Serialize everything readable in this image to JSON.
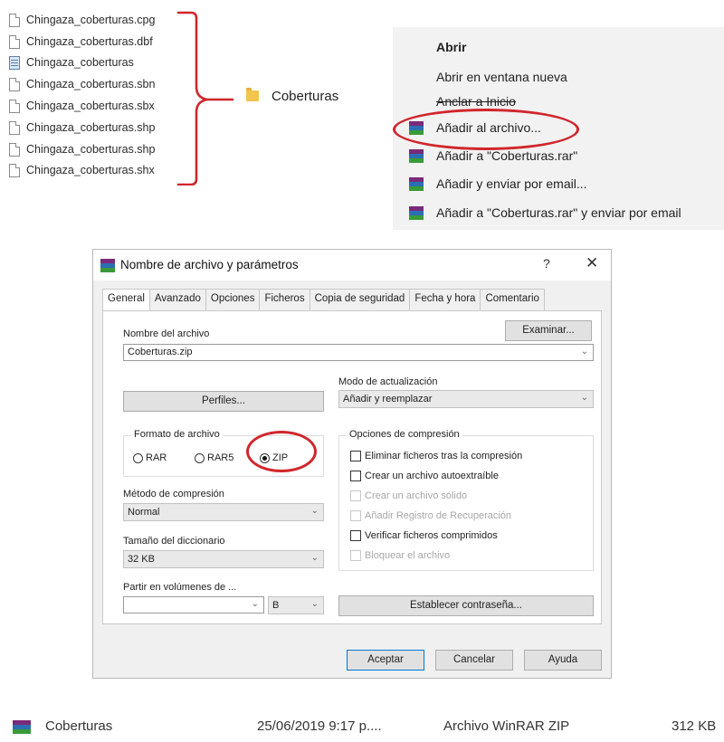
{
  "files": [
    {
      "name": "Chingaza_coberturas.cpg",
      "icon": "document-icon"
    },
    {
      "name": "Chingaza_coberturas.dbf",
      "icon": "document-icon"
    },
    {
      "name": "Chingaza_coberturas",
      "icon": "table-icon"
    },
    {
      "name": "Chingaza_coberturas.sbn",
      "icon": "document-icon"
    },
    {
      "name": "Chingaza_coberturas.sbx",
      "icon": "document-icon"
    },
    {
      "name": "Chingaza_coberturas.shp",
      "icon": "document-icon"
    },
    {
      "name": "Chingaza_coberturas.shp",
      "icon": "document-icon"
    },
    {
      "name": "Chingaza_coberturas.shx",
      "icon": "document-icon"
    }
  ],
  "folder": {
    "name": "Coberturas",
    "icon": "folder-icon"
  },
  "context_menu": {
    "items": [
      {
        "label": "Abrir",
        "icon": null
      },
      {
        "label": "Abrir en ventana nueva",
        "icon": null
      },
      {
        "label": "Anclar a Inicio",
        "icon": null
      },
      {
        "label": "Añadir al archivo...",
        "icon": "winrar-icon"
      },
      {
        "label": "Añadir a \"Coberturas.rar\"",
        "icon": "winrar-icon"
      },
      {
        "label": "Añadir y enviar por email...",
        "icon": "winrar-icon"
      },
      {
        "label": "Añadir a \"Coberturas.rar\" y enviar por email",
        "icon": "winrar-icon"
      }
    ]
  },
  "dialog": {
    "title": "Nombre de archivo y parámetros",
    "help": "?",
    "close": "✕",
    "tabs": [
      "General",
      "Avanzado",
      "Opciones",
      "Ficheros",
      "Copia de seguridad",
      "Fecha y hora",
      "Comentario"
    ],
    "archive_name_label": "Nombre del archivo",
    "browse_button": "Examinar...",
    "archive_name_value": "Coberturas.zip",
    "profiles_button": "Perfiles...",
    "update_mode_label": "Modo de actualización",
    "update_mode_value": "Añadir y reemplazar",
    "format_label": "Formato de archivo",
    "formats": [
      {
        "label": "RAR",
        "selected": false
      },
      {
        "label": "RAR5",
        "selected": false
      },
      {
        "label": "ZIP",
        "selected": true
      }
    ],
    "compression_options_label": "Opciones de compresión",
    "compression_options": [
      {
        "label": "Eliminar ficheros tras la compresión",
        "checked": false,
        "enabled": true
      },
      {
        "label": "Crear un archivo autoextraíble",
        "checked": false,
        "enabled": true
      },
      {
        "label": "Crear un archivo sólido",
        "checked": false,
        "enabled": false
      },
      {
        "label": "Añadir Registro de Recuperación",
        "checked": false,
        "enabled": false
      },
      {
        "label": "Verificar ficheros comprimidos",
        "checked": false,
        "enabled": true
      },
      {
        "label": "Bloquear el archivo",
        "checked": false,
        "enabled": false
      }
    ],
    "method_label": "Método de compresión",
    "method_value": "Normal",
    "dict_label": "Tamaño del diccionario",
    "dict_value": "32 KB",
    "split_label": "Partir en volúmenes de ...",
    "split_value": "",
    "split_unit": "B",
    "password_button": "Establecer contraseña...",
    "ok_button": "Aceptar",
    "cancel_button": "Cancelar",
    "help_button": "Ayuda"
  },
  "result_file": {
    "name": "Coberturas",
    "date": "25/06/2019 9:17 p....",
    "type": "Archivo WinRAR ZIP",
    "size": "312 KB"
  },
  "colors": {
    "annotation_red": "#d0262c",
    "context_menu_bg": "#f2f2f2",
    "dialog_bg": "#f0f0f0",
    "accent_blue": "#0078d7"
  }
}
